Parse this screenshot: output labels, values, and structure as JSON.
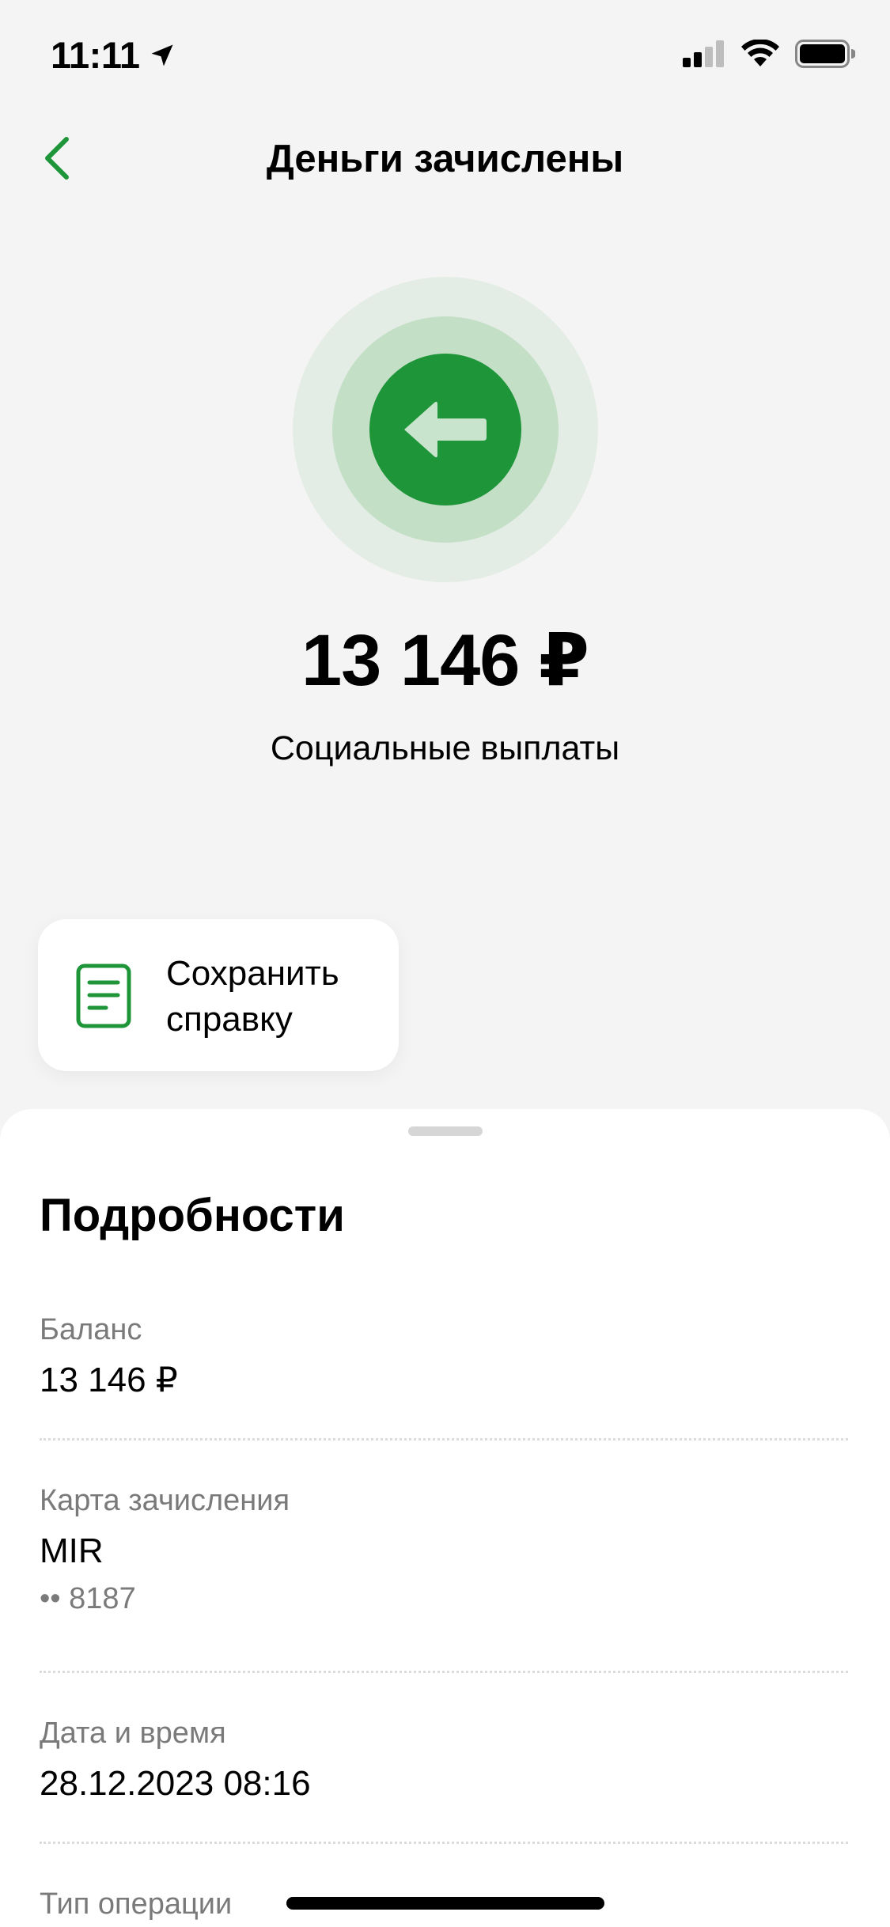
{
  "status_bar": {
    "time": "11:11"
  },
  "header": {
    "title": "Деньги зачислены"
  },
  "hero": {
    "amount": "13 146 ₽",
    "category": "Социальные выплаты"
  },
  "actions": {
    "save_receipt_label": "Сохранить\nсправку"
  },
  "details": {
    "title": "Подробности",
    "balance_label": "Баланс",
    "balance_value": "13 146 ₽",
    "card_label": "Карта зачисления",
    "card_value": "MIR",
    "card_number": "•• 8187",
    "datetime_label": "Дата и время",
    "datetime_value": "28.12.2023 08:16",
    "operation_type_label": "Тип операции"
  },
  "colors": {
    "accent_green": "#1e9538",
    "ring_light": "#e4ede5",
    "ring_mid": "#c3dfc6",
    "background": "#f4f4f4",
    "secondary_text": "#7a7a7a"
  },
  "icons": {
    "back": "chevron-left-icon",
    "hero": "arrow-left-icon",
    "save": "document-icon",
    "location": "location-arrow-icon",
    "signal": "cellular-signal-icon",
    "wifi": "wifi-icon",
    "battery": "battery-icon"
  }
}
